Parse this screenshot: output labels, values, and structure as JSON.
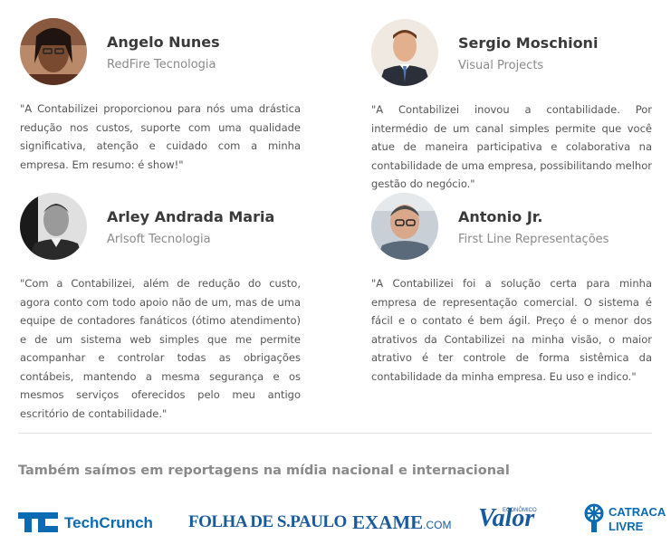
{
  "testimonials": [
    {
      "name": "Angelo Nunes",
      "company": "RedFire Tecnologia",
      "quote": "\"A Contabilizei proporcionou para nós uma drástica redução nos custos, suporte com uma qualidade significativa, atenção e cuidado com a minha empresa. Em resumo: é show!\""
    },
    {
      "name": "Sergio Moschioni",
      "company": "Visual Projects",
      "quote": "\"A Contabilizei inovou a contabilidade. Por intermédio de um canal simples permite que você atue de maneira participativa e colaborativa na contabilidade de uma empresa, possibilitando melhor gestão do negócio.\""
    },
    {
      "name": "Arley Andrada Maria",
      "company": "Arlsoft Tecnologia",
      "quote": "\"Com a Contabilizei, além de redução do custo, agora conto com todo apoio não de um, mas de uma equipe de contadores fanáticos (ótimo atendimento) e de um sistema web simples que me permite acompanhar e controlar todas as obrigações contábeis, mantendo a mesma segurança e os mesmos serviços oferecidos pelo meu antigo escritório de contabilidade.\""
    },
    {
      "name": "Antonio Jr.",
      "company": "First Line Representações",
      "quote": "\"A Contabilizei foi a solução certa para minha empresa de representação comercial. O sistema é fácil e o contato é bem ágil. Preço é o menor dos atrativos da Contabilizei na minha visão, o maior atrativo é ter controle de forma sistêmica da contabilidade da minha empresa. Eu uso e indico.\""
    }
  ],
  "media": {
    "title": "Também saímos em reportagens na mídia nacional e internacional",
    "logos": {
      "techcrunch": "TechCrunch",
      "folha": "FOLHA DE S.PAULO",
      "exame": "EXAME",
      "exame_suffix": ".COM",
      "valor": "Valor",
      "valor_tag": "ECONÔMICO",
      "catraca_line1": "CATRACA",
      "catraca_line2": "LIVRE"
    }
  },
  "colors": {
    "name": "#3a3a3a",
    "company": "#8a8a8a",
    "quote": "#555555",
    "brand_blue": "#1a5a9c",
    "techcrunch_blue": "#0a6bb5"
  }
}
